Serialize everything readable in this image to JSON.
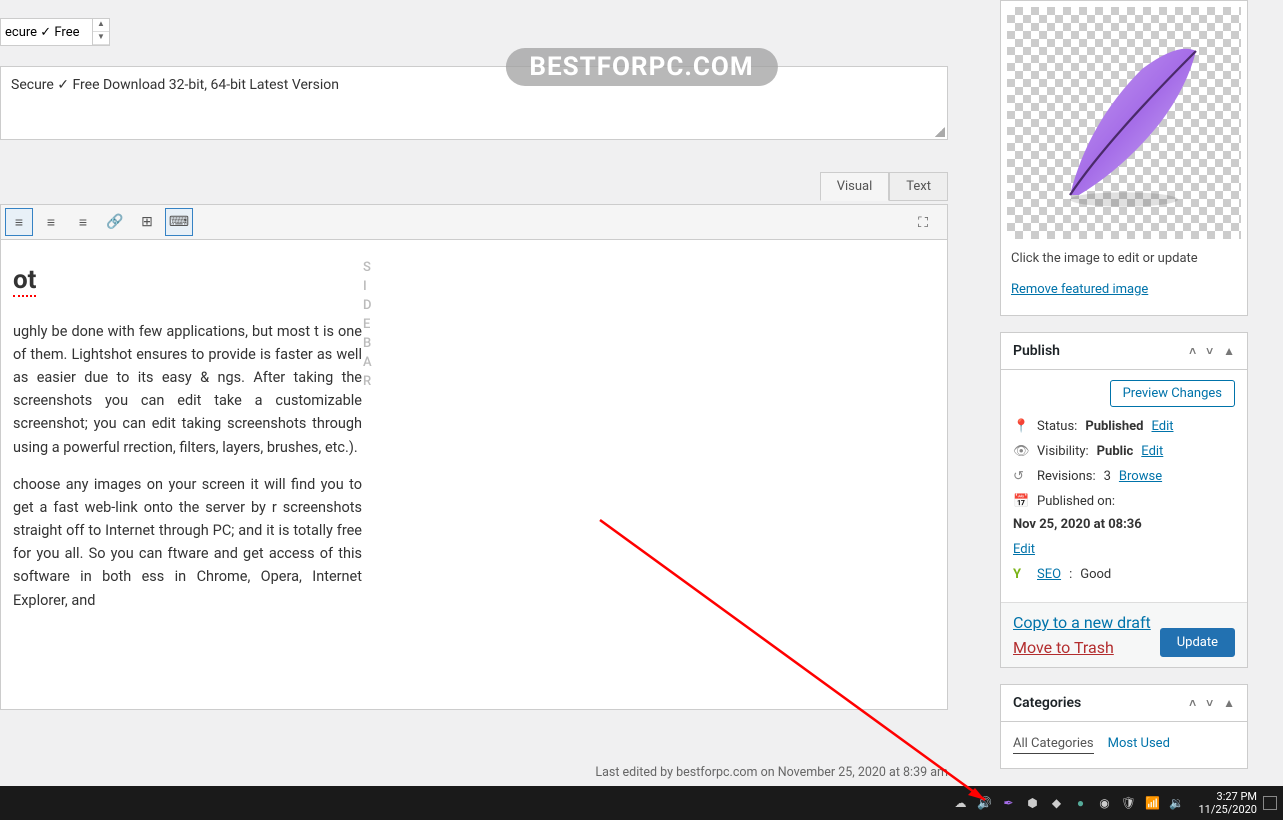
{
  "watermark": "BESTFORPC.COM",
  "title_field": "ecure ✓ Free",
  "description": "Secure ✓ Free Download 32-bit, 64-bit Latest Version",
  "editor": {
    "tabs": {
      "visual": "Visual",
      "text": "Text"
    },
    "heading_suffix": "ot",
    "para1": "ughly be done with few applications, but most t is one of them. Lightshot ensures to provide is faster as well as easier due to its easy & ngs. After taking the screenshots you can edit take a customizable screenshot; you can edit taking screenshots through using a powerful rrection, filters, layers, brushes, etc.).",
    "para2": "choose any images on your screen it will find you to get a fast web-link onto the server by r screenshots straight off to Internet through PC; and it is totally free for you all. So you can ftware and get access of this software in both ess in Chrome, Opera, Internet Explorer, and",
    "sidebar_letters": [
      "S",
      "I",
      "D",
      "E",
      "B",
      "A",
      "R"
    ]
  },
  "last_edited": "Last edited by bestforpc.com on November 25, 2020 at 8:39 am",
  "featured": {
    "caption": "Click the image to edit or update",
    "remove": "Remove featured image"
  },
  "publish": {
    "title": "Publish",
    "preview": "Preview Changes",
    "status_label": "Status:",
    "status_value": "Published",
    "edit": "Edit",
    "visibility_label": "Visibility:",
    "visibility_value": "Public",
    "revisions_label": "Revisions:",
    "revisions_value": "3",
    "browse": "Browse",
    "published_label": "Published on:",
    "published_value": "Nov 25, 2020 at 08:36",
    "seo_label": "SEO",
    "seo_value": "Good",
    "copy": "Copy to a new draft",
    "trash": "Move to Trash",
    "update": "Update"
  },
  "categories": {
    "title": "Categories",
    "tab_all": "All Categories",
    "tab_used": "Most Used"
  },
  "taskbar": {
    "time": "3:27 PM",
    "date": "11/25/2020"
  }
}
